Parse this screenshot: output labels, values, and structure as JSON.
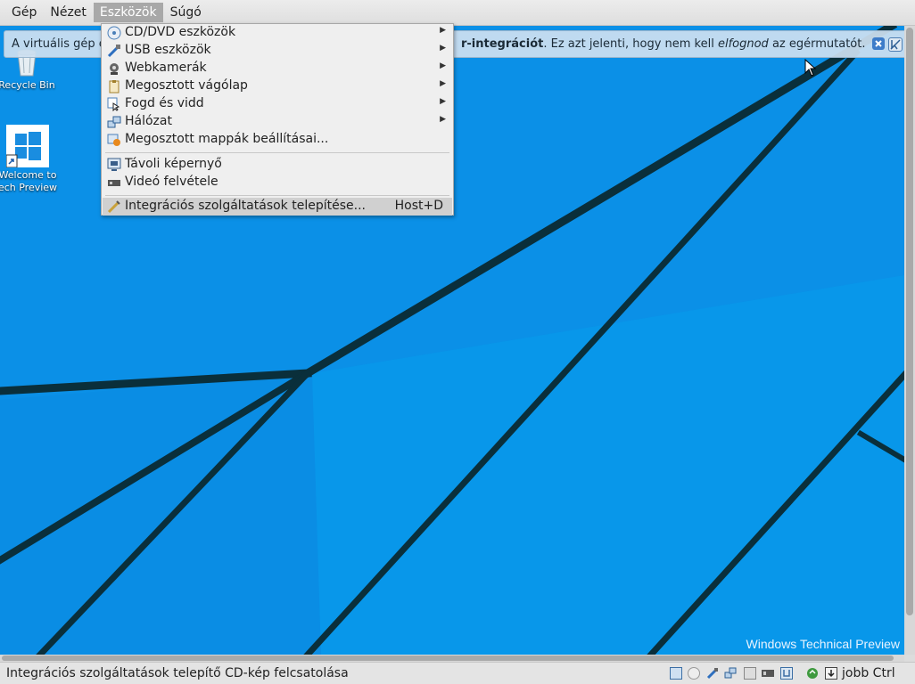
{
  "menubar": {
    "items": [
      "Gép",
      "Nézet",
      "Eszközök",
      "Súgó"
    ],
    "active": "Eszközök"
  },
  "notification": {
    "text_left": "A virtuális gép é",
    "text_bold": "r-integrációt",
    "text_mid": ". Ez azt jelenti, hogy nem kell ",
    "text_italic": "elfognod",
    "text_end": " az egérmutatót."
  },
  "menu": {
    "items": [
      {
        "label": "CD/DVD eszközök",
        "icon": "cd-icon",
        "submenu": true
      },
      {
        "label": "USB eszközök",
        "icon": "usb-icon",
        "submenu": true
      },
      {
        "label": "Webkamerák",
        "icon": "webcam-icon",
        "submenu": true
      },
      {
        "label": "Megosztott vágólap",
        "icon": "clipboard-icon",
        "submenu": true
      },
      {
        "label": "Fogd és vidd",
        "icon": "drag-drop-icon",
        "submenu": true
      },
      {
        "label": "Hálózat",
        "icon": "network-icon",
        "submenu": true
      },
      {
        "label": "Megosztott mappák beállításai...",
        "icon": "shared-folder-icon",
        "submenu": false
      },
      {
        "label": "Távoli képernyő",
        "icon": "remote-display-icon",
        "submenu": false
      },
      {
        "label": "Videó felvétele",
        "icon": "video-capture-icon",
        "submenu": false
      },
      {
        "label": "Integrációs szolgáltatások telepítése...",
        "icon": "install-guest-additions-icon",
        "submenu": false,
        "shortcut": "Host+D",
        "highlighted": true
      }
    ]
  },
  "desktop": {
    "recycle_bin_label": "Recycle Bin",
    "welcome_label_1": "Welcome to",
    "welcome_label_2": "ech Preview",
    "watermark": "Windows Technical Preview"
  },
  "statusbar": {
    "text": "Integrációs szolgáltatások telepítő CD-kép felcsatolása",
    "host_key": "jobb Ctrl"
  },
  "colors": {
    "wallpaper": "#0b8fe6",
    "menu_highlight": "#d0d0d0",
    "menubar_active": "#a8a8a8"
  }
}
